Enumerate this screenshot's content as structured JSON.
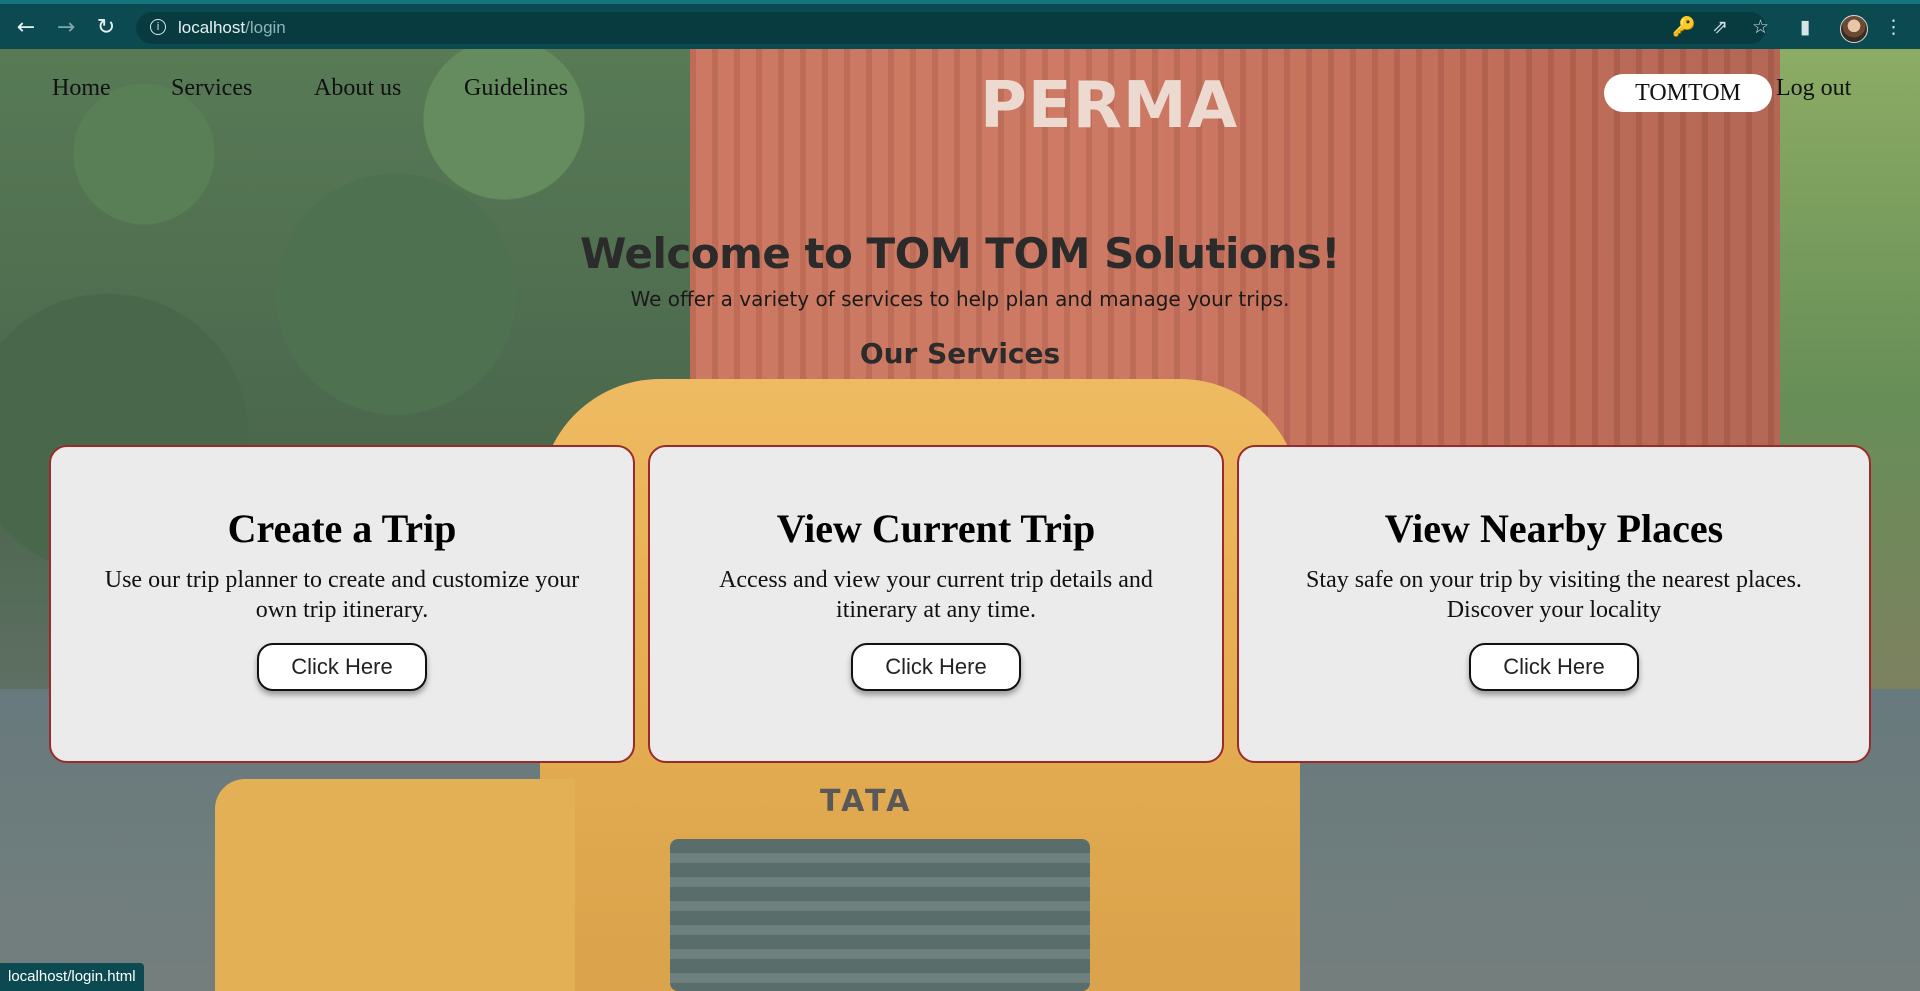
{
  "browser": {
    "back_icon": "arrow-left-icon",
    "forward_icon": "arrow-right-icon",
    "reload_icon": "reload-icon",
    "url_host": "localhost",
    "url_path": "/login",
    "key_icon": "key-icon",
    "share_icon": "share-icon",
    "star_icon": "star-icon",
    "sidepanel_icon": "side-panel-icon",
    "menu_icon": "kebab-menu-icon"
  },
  "nav": {
    "links": [
      "Home",
      "Services",
      "About us",
      "Guidelines"
    ],
    "user": "TOMTOM",
    "logout": "Log out"
  },
  "hero": {
    "title": "Welcome to TOM TOM Solutions!",
    "subtitle": "We offer a variety of services to help plan and manage your trips.",
    "section_title": "Our Services"
  },
  "cards": [
    {
      "title": "Create a Trip",
      "description": "Use our trip planner to create and customize your own trip itinerary.",
      "button": "Click Here"
    },
    {
      "title": "View Current Trip",
      "description": "Access and view your current trip details and itinerary at any time.",
      "button": "Click Here"
    },
    {
      "title": "View Nearby Places",
      "description": "Stay safe on your trip by visiting the nearest places. Discover your locality",
      "button": "Click Here"
    }
  ],
  "background_text": {
    "container_label": "PERMA",
    "truck_brand": "TATA"
  },
  "status_bar": "localhost/login.html",
  "colors": {
    "card_border": "#9b2a2a",
    "card_background": "#ebebeb",
    "chrome": "#0c4a51"
  }
}
